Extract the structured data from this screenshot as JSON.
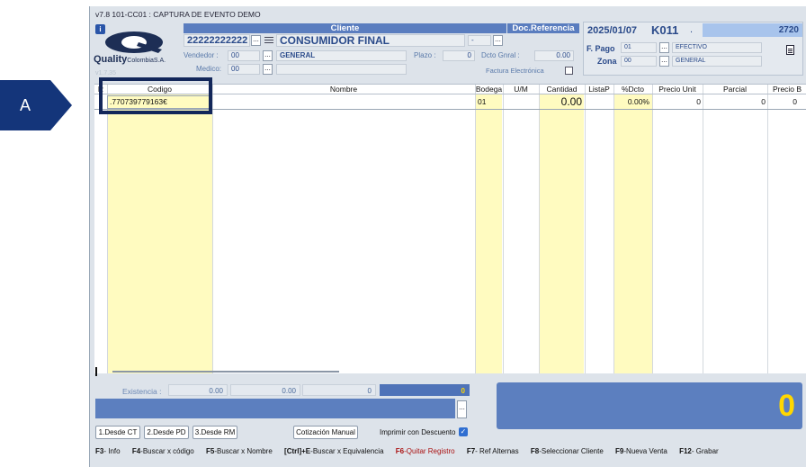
{
  "callout": {
    "letter": "A"
  },
  "window": {
    "title": "v7.8 101-CC01 : CAPTURA DE EVENTO DEMO"
  },
  "brand": {
    "name": "Quality",
    "suffix": "ColombiaS.A.",
    "ghost_version": "v1.7.35"
  },
  "header": {
    "cliente_label": "Cliente",
    "doc_ref_label": "Doc.Referencia",
    "client_id": "22222222222",
    "client_name": "CONSUMIDOR FINAL",
    "vendedor_label": "Vendedor :",
    "vendedor_code": "00",
    "vendedor_name": "GENERAL",
    "medico_label": "Medico:",
    "medico_code": "00",
    "plazo_label": "Plazo :",
    "plazo_value": "0",
    "dcto_label": "Dcto Gnral :",
    "dcto_value": "0.00",
    "doc_ref_value": "-",
    "factura_label": "Factura Electrónica"
  },
  "doc": {
    "date": "2025/01/07",
    "code": "K011",
    "dot": ".",
    "number": "2720",
    "fpago_label": "F. Pago",
    "fpago_code": "01",
    "fpago_name": "EFECTIVO",
    "zona_label": "Zona",
    "zona_code": "00",
    "zona_name": "GENERAL"
  },
  "grid": {
    "columns": [
      "R",
      "Codigo",
      "Nombre",
      "Bodega",
      "U/M",
      "Cantidad",
      "ListaP",
      "%Dcto",
      "Precio Unit",
      "Parcial",
      "Precio B"
    ],
    "row": {
      "codigo": ".770739779163€",
      "bodega": "01",
      "cantidad": "0.00",
      "dcto": "0.00%",
      "precio_unit": "0",
      "parcial": "0",
      "precio_b": "0"
    }
  },
  "bottom": {
    "existencia_label": "Existencia :",
    "exist_1": "0.00",
    "exist_2": "0.00",
    "exist_3": "0",
    "exist_4": "0",
    "total": "0",
    "btn_ct": "1.Desde CT",
    "btn_pd": "2.Desde PD",
    "btn_rm": "3.Desde RM",
    "btn_cotizacion": "Cotización Manual",
    "imprimir_label": "Imprimir con Descuento"
  },
  "fkeys": {
    "f3_key": "F3",
    "f3_text": "- Info",
    "f4_key": "F4",
    "f4_text": "-Buscar x código",
    "f5_key": "F5",
    "f5_text": "-Buscar x Nombre",
    "ctrl_key": "[Ctrl]+E",
    "ctrl_text": "-Buscar x Equivalencia",
    "f6_key": "F6",
    "f6_text": "-Quitar Registro",
    "f7_key": "F7",
    "f7_text": "- Ref Alternas",
    "f8_key": "F8",
    "f8_text": "-Seleccionar Cliente",
    "f9_key": "F9",
    "f9_text": "-Nueva Venta",
    "f12_key": "F12",
    "f12_text": "- Grabar"
  },
  "colors": {
    "header_blue": "#5a7dbf",
    "total_panel": "#5c7fbf",
    "total_text": "#ffd700",
    "yellow_column": "#fffbc0",
    "callout_navy": "#14357a"
  }
}
